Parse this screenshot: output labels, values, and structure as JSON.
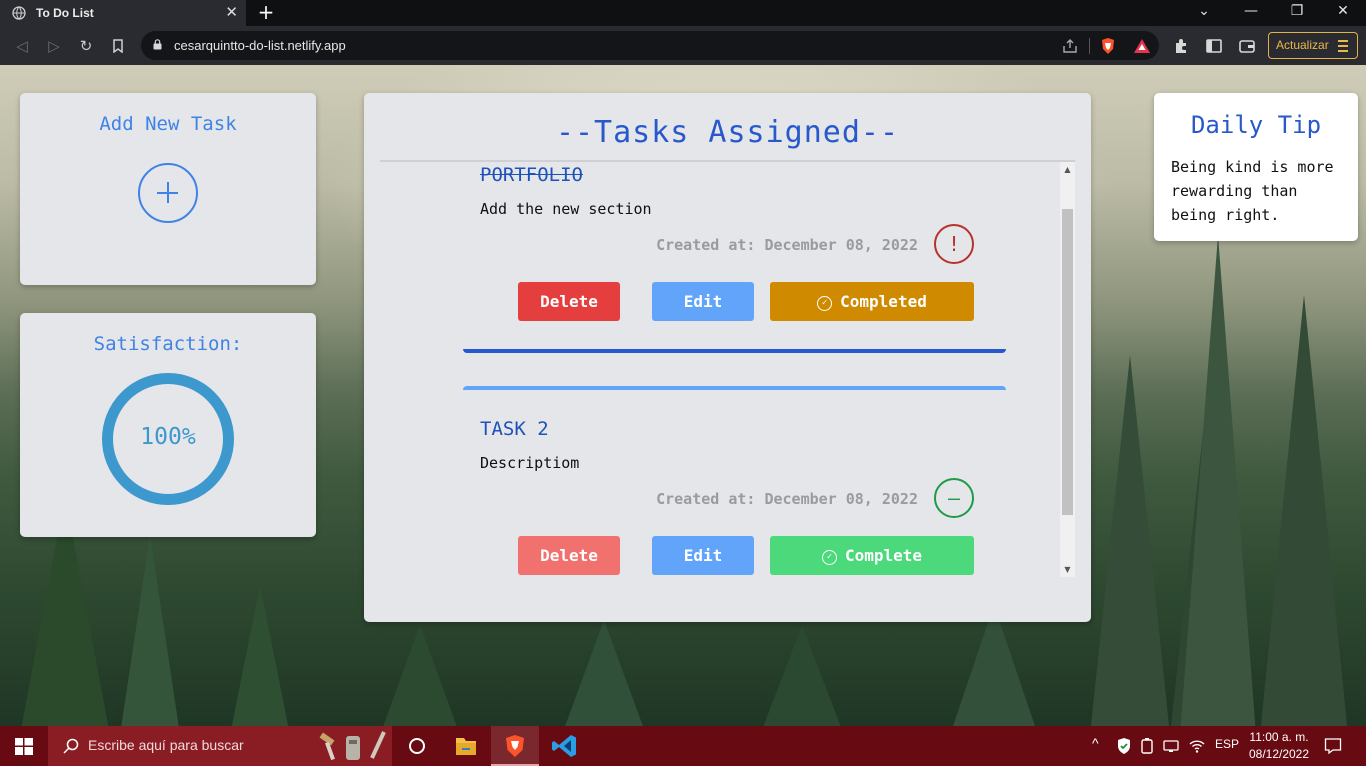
{
  "browser": {
    "tab_title": "To Do List",
    "tab_close": "✕",
    "new_tab": "+",
    "url": "cesarquintto-do-list.netlify.app",
    "update_label": "Actualizar",
    "window_controls": {
      "minimize": "—",
      "restore": "❐",
      "close": "✕"
    }
  },
  "add_task": {
    "title": "Add New Task"
  },
  "satisfaction": {
    "title": "Satisfaction:",
    "value": "100%",
    "level_percent": 100,
    "color": "#3d98cd"
  },
  "tasks_panel": {
    "title": "--Tasks Assigned--",
    "tasks": [
      {
        "title": "PORTFOLIO",
        "description": "Add the new section",
        "created": "Created at: December 08, 2022",
        "status_symbol": "!",
        "status_color": "#b8322c",
        "delete_label": "Delete",
        "edit_label": "Edit",
        "complete_label": "Completed",
        "complete_color": "#cf8a00"
      },
      {
        "title": "TASK 2",
        "description": "Descriptiom",
        "created": "Created at: December 08, 2022",
        "status_symbol": "—",
        "status_color": "#1d9b49",
        "delete_label": "Delete",
        "edit_label": "Edit",
        "complete_label": "Complete",
        "complete_color": "#4cd97b"
      }
    ]
  },
  "daily_tip": {
    "title": "Daily Tip",
    "text": "Being kind is more rewarding than being right."
  },
  "taskbar": {
    "search_placeholder": "Escribe aquí para buscar",
    "language": "ESP",
    "time": "11:00 a. m.",
    "date": "08/12/2022"
  },
  "colors": {
    "accent_blue": "#3f83e6",
    "title_blue": "#2759cc",
    "delete_red": "#e53e3e",
    "edit_blue": "#63a4fb"
  }
}
